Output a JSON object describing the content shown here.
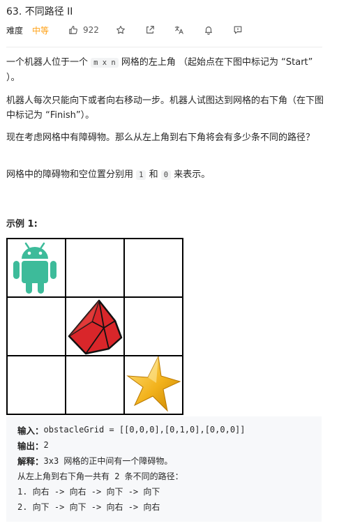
{
  "header": {
    "title": "63. 不同路径 II"
  },
  "meta": {
    "difficulty_label": "难度",
    "difficulty_value": "中等",
    "like_count": "922",
    "icons": [
      "thumbs-up-icon",
      "star-icon",
      "share-icon",
      "translate-icon",
      "bell-icon",
      "feedback-icon"
    ],
    "difficulty_color": "#ffa116"
  },
  "description": {
    "p1_a": "一个机器人位于一个 ",
    "p1_code": "m x n",
    "p1_b": " 网格的左上角 （起始点在下图中标记为 “Start” ）。",
    "p2": "机器人每次只能向下或者向右移动一步。机器人试图达到网格的右下角（在下图中标记为 “Finish”）。",
    "p3": "现在考虑网格中有障碍物。那么从左上角到右下角将会有多少条不同的路径？",
    "p4_a": "网格中的障碍物和空位置分别用 ",
    "p4_code1": "1",
    "p4_mid": " 和 ",
    "p4_code2": "0",
    "p4_b": " 来表示。"
  },
  "example": {
    "title": "示例 1:",
    "grid_icons": [
      "android-robot-icon",
      "obstacle-gem-icon",
      "finish-star-icon"
    ],
    "input_label": "输入：",
    "input_value": "obstacleGrid = [[0,0,0],[0,1,0],[0,0,0]]",
    "output_label": "输出：",
    "output_value": "2",
    "explain_label": "解释：",
    "explain_value": "3x3 网格的正中间有一个障碍物。",
    "line4": "从左上角到右下角一共有 2 条不同的路径：",
    "line5": "1. 向右 -> 向右 -> 向下 -> 向下",
    "line6": "2. 向下 -> 向下 -> 向右 -> 向右"
  }
}
